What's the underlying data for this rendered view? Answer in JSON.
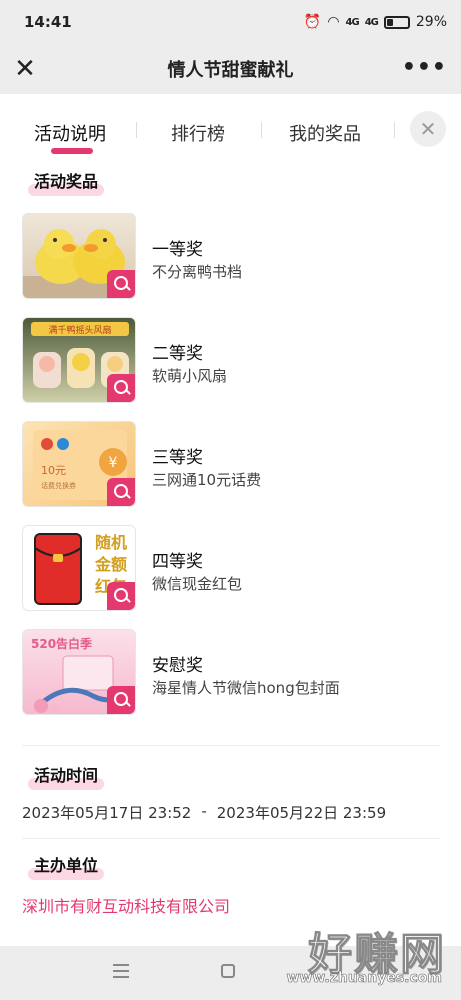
{
  "status": {
    "time": "14:41",
    "signal1": "4G",
    "signal2": "4G",
    "battery": "29%"
  },
  "titlebar": {
    "title": "情人节甜蜜献礼"
  },
  "tabs": [
    {
      "label": "活动说明"
    },
    {
      "label": "排行榜"
    },
    {
      "label": "我的奖品"
    }
  ],
  "prizes_section": {
    "title": "活动奖品"
  },
  "prizes": [
    {
      "name": "一等奖",
      "desc": "不分离鸭书档"
    },
    {
      "name": "二等奖",
      "desc": "软萌小风扇",
      "thumb_text": "满千鸭摇头风扇"
    },
    {
      "name": "三等奖",
      "desc": "三网通10元话费",
      "thumb_text": "10元",
      "thumb_sub": "话费兑换券"
    },
    {
      "name": "四等奖",
      "desc": "微信现金红包",
      "thumb_text": "随机金额红包"
    },
    {
      "name": "安慰奖",
      "desc": "海星情人节微信hong包封面",
      "thumb_text": "520告白季"
    }
  ],
  "time_section": {
    "title": "活动时间",
    "start": "2023年05月17日 23:52",
    "sep": "-",
    "end": "2023年05月22日 23:59"
  },
  "org_section": {
    "title": "主办单位",
    "name": "深圳市有财互动科技有限公司"
  },
  "watermark": {
    "main": "好赚网",
    "url": "www.zhuanyes.com"
  },
  "colors": {
    "accent": "#e4396e",
    "highlight": "#fbd8e4",
    "bar": "#ededed"
  }
}
